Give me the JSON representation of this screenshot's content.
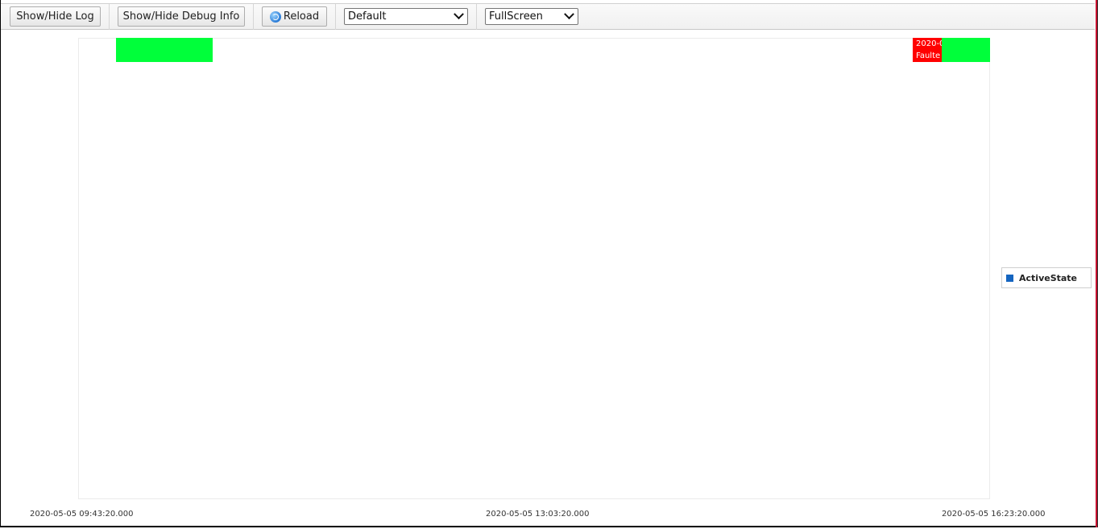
{
  "toolbar": {
    "show_hide_log": "Show/Hide Log",
    "show_hide_debug": "Show/Hide Debug Info",
    "reload": "Reload",
    "layout_select": "Default",
    "view_select": "FullScreen"
  },
  "chart_data": {
    "type": "timeline",
    "series": [
      {
        "name": "ActiveState",
        "segments": [
          {
            "state": "active",
            "color": "#00ff3a"
          },
          {
            "state": "faulted",
            "color": "#ff0000",
            "label_line1": "2020-0",
            "label_line2": "Faulte"
          },
          {
            "state": "active",
            "color": "#00ff3a"
          }
        ]
      }
    ],
    "x_ticks": [
      "2020-05-05 09:43:20.000",
      "2020-05-05 13:03:20.000",
      "2020-05-05 16:23:20.000"
    ],
    "legend": {
      "label": "ActiveState",
      "color": "#1565c0",
      "placement": "right"
    }
  }
}
